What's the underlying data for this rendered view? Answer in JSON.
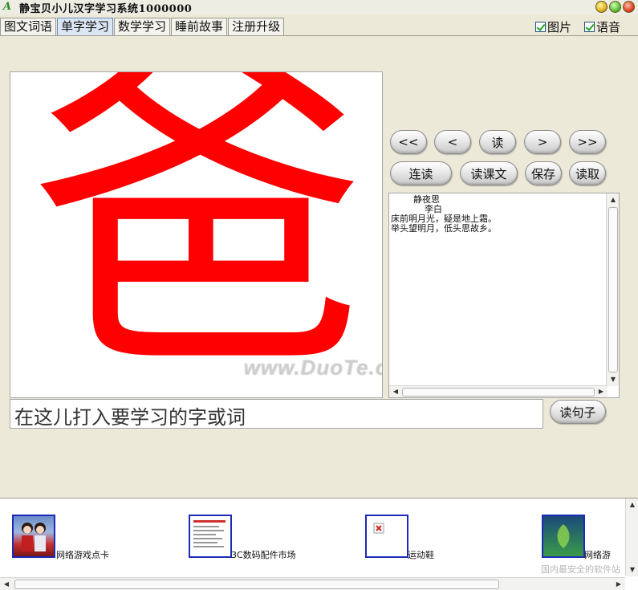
{
  "window": {
    "title": "静宝贝小儿汉字学习系统1000000",
    "icon_glyph": "A"
  },
  "tabs": [
    {
      "label": "图文词语",
      "active": false
    },
    {
      "label": "单字学习",
      "active": true
    },
    {
      "label": "数学学习",
      "active": false
    },
    {
      "label": "睡前故事",
      "active": false
    },
    {
      "label": "注册升级",
      "active": false
    }
  ],
  "options": {
    "picture_label": "图片",
    "picture_checked": true,
    "voice_label": "语音",
    "voice_checked": true
  },
  "display": {
    "character": "爸",
    "character_color": "#ff0000",
    "watermark": "www.DuoTe.com"
  },
  "nav_buttons": {
    "first": "<<",
    "prev": "<",
    "read": "读",
    "next": ">",
    "last": ">>"
  },
  "action_buttons": {
    "continuous_read": "连读",
    "read_text": "读课文",
    "save": "保存",
    "load": "读取"
  },
  "poem": {
    "text": "        静夜思\n            李白\n床前明月光，疑是地上霜。\n举头望明月，低头思故乡。"
  },
  "input": {
    "value": "在这儿打入要学习的字或词"
  },
  "read_sentence_button": "读句子",
  "ads": [
    {
      "label": "网络游戏点卡",
      "icon": "couple-photo-icon"
    },
    {
      "label": "3C数码配件市场",
      "icon": "webpage-thumbnail-icon"
    },
    {
      "label": "运动鞋",
      "icon": "broken-image-icon"
    },
    {
      "label": "网络游",
      "icon": "game-logo-icon"
    }
  ],
  "corner_watermark": "国内最安全的软件站"
}
